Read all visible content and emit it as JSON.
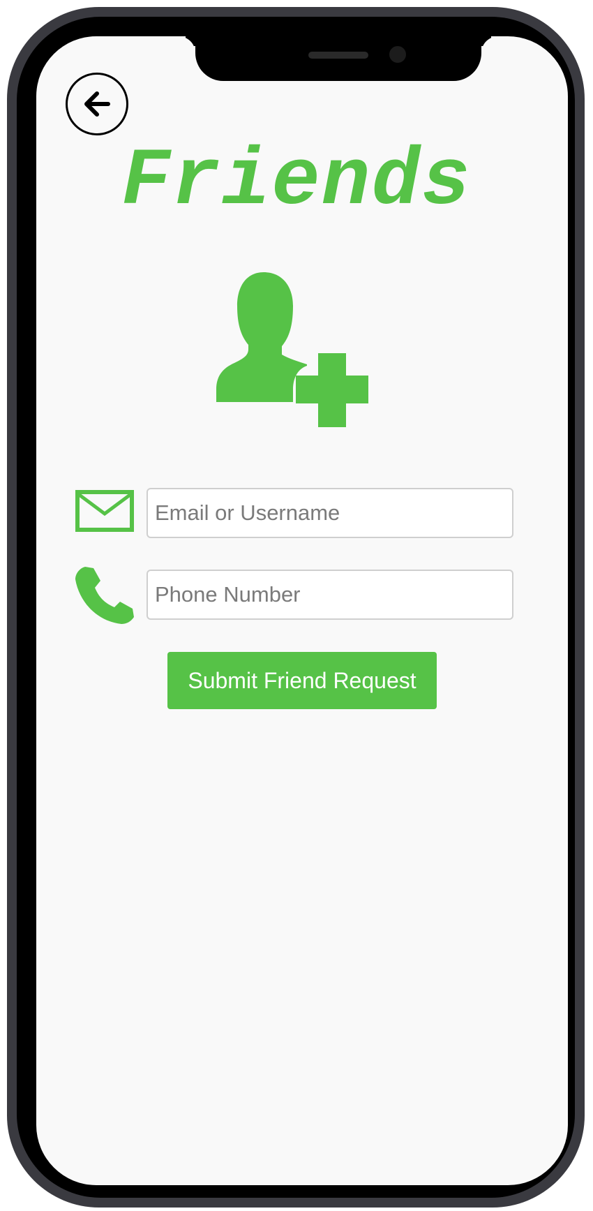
{
  "page": {
    "title": "Friends"
  },
  "form": {
    "email_placeholder": "Email or Username",
    "phone_placeholder": "Phone Number",
    "email_value": "",
    "phone_value": "",
    "submit_label": "Submit Friend Request"
  },
  "icons": {
    "back": "arrow-left-icon",
    "add_user": "add-user-icon",
    "email": "envelope-icon",
    "phone": "phone-icon"
  },
  "colors": {
    "accent": "#56c247",
    "background": "#f9f9f9",
    "frame": "#3a3a40"
  }
}
